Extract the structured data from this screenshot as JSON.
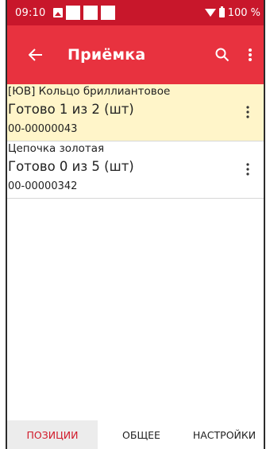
{
  "status_bar": {
    "time": "09:10",
    "battery_text": "100 %",
    "icons": [
      "image-icon",
      "notification-block-icon",
      "notification-block-icon",
      "notification-block-icon",
      "wifi-icon",
      "battery-icon"
    ]
  },
  "app_bar": {
    "title": "Приёмка",
    "back_icon": "arrow-left-icon",
    "search_icon": "search-icon",
    "more_icon": "more-vert-icon"
  },
  "list": {
    "items": [
      {
        "name": "[ЮВ] Кольцо бриллиантовое",
        "status": "Готово 1 из 2 (шт)",
        "code": "00-00000043",
        "selected": true
      },
      {
        "name": "Цепочка золотая",
        "status": "Готово 0 из 5 (шт)",
        "code": "00-00000342",
        "selected": false
      }
    ]
  },
  "tabs": [
    {
      "label": "ПОЗИЦИИ",
      "active": true
    },
    {
      "label": "ОБЩЕЕ",
      "active": false
    },
    {
      "label": "НАСТРОЙКИ",
      "active": false
    }
  ],
  "colors": {
    "status_bar": "#c8172b",
    "app_bar": "#e8323f",
    "selected_row": "#fff5c9",
    "active_tab_text": "#d11a2a"
  }
}
